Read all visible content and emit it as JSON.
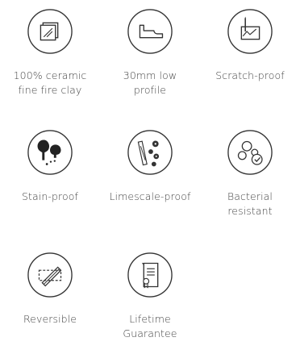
{
  "features": [
    {
      "label": "100% ceramic\nfine fire clay",
      "icon": "ceramic-tile-icon"
    },
    {
      "label": "30mm low\nprofile",
      "icon": "low-profile-icon"
    },
    {
      "label": "Scratch-proof",
      "icon": "scratch-proof-icon"
    },
    {
      "label": "Stain-proof",
      "icon": "stain-drops-icon"
    },
    {
      "label": "Limescale-proof",
      "icon": "limescale-icon"
    },
    {
      "label": "Bacterial\nresistant",
      "icon": "bacteria-icon"
    },
    {
      "label": "Reversible",
      "icon": "reversible-icon"
    },
    {
      "label": "Lifetime\nGuarantee",
      "icon": "certificate-icon"
    }
  ]
}
